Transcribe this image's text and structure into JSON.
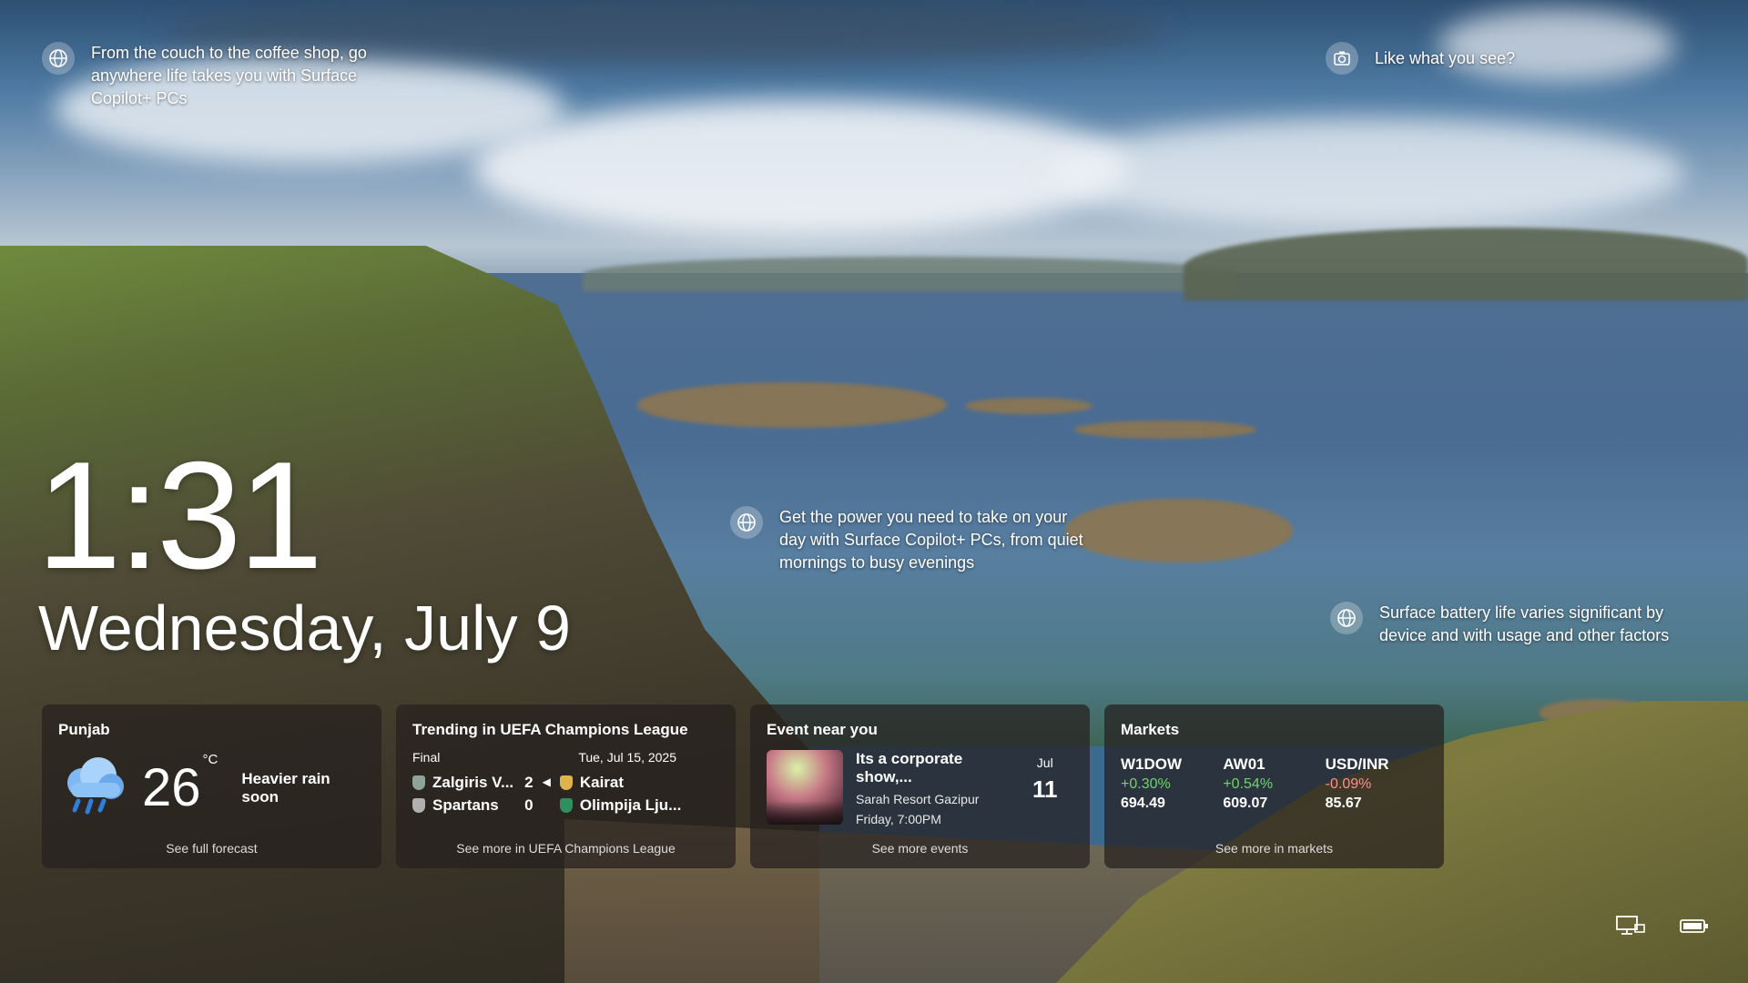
{
  "background": {
    "spotlight_1": "From the couch to the coffee shop, go anywhere life takes you with Surface Copilot+ PCs",
    "spotlight_2": "Get the power you need to take on your day with Surface Copilot+ PCs, from quiet mornings to busy evenings",
    "spotlight_3": "Surface battery life varies significant by device and with usage and other factors",
    "like_prompt": "Like what you see?"
  },
  "lock": {
    "time": "1:31",
    "date": "Wednesday, July 9"
  },
  "weather": {
    "location": "Punjab",
    "temperature": "26",
    "unit": "°C",
    "condition": "Heavier rain soon",
    "link": "See full forecast",
    "icon": "rain-cloud-icon"
  },
  "sports": {
    "title": "Trending in UEFA Champions League",
    "status": "Final",
    "date": "Tue, Jul 15, 2025",
    "home": [
      {
        "name": "Zalgiris V...",
        "score": "2",
        "color": "#8fa39a"
      },
      {
        "name": "Spartans",
        "score": "0",
        "color": "#b0b0b0"
      }
    ],
    "winner_marker": "◀",
    "away": [
      {
        "name": "Kairat",
        "color": "#e0b34a"
      },
      {
        "name": "Olimpija Lju...",
        "color": "#2f8f5e"
      }
    ],
    "link": "See more in UEFA Champions League"
  },
  "event": {
    "title": "Event near you",
    "name": "Its a corporate show,...",
    "venue": "Sarah Resort Gazipur",
    "when": "Friday, 7:00PM",
    "month": "Jul",
    "day": "11",
    "link": "See more events"
  },
  "markets": {
    "title": "Markets",
    "items": [
      {
        "symbol": "W1DOW",
        "change": "+0.30%",
        "value": "694.49",
        "trend": "up"
      },
      {
        "symbol": "AW01",
        "change": "+0.54%",
        "value": "609.07",
        "trend": "up"
      },
      {
        "symbol": "USD/INR",
        "change": "-0.09%",
        "value": "85.67",
        "trend": "down"
      }
    ],
    "up_color": "#6fd36f",
    "down_color": "#ff8e8e",
    "link": "See more in markets"
  },
  "tray": {
    "network_icon": "network-icon",
    "battery_icon": "battery-icon"
  }
}
